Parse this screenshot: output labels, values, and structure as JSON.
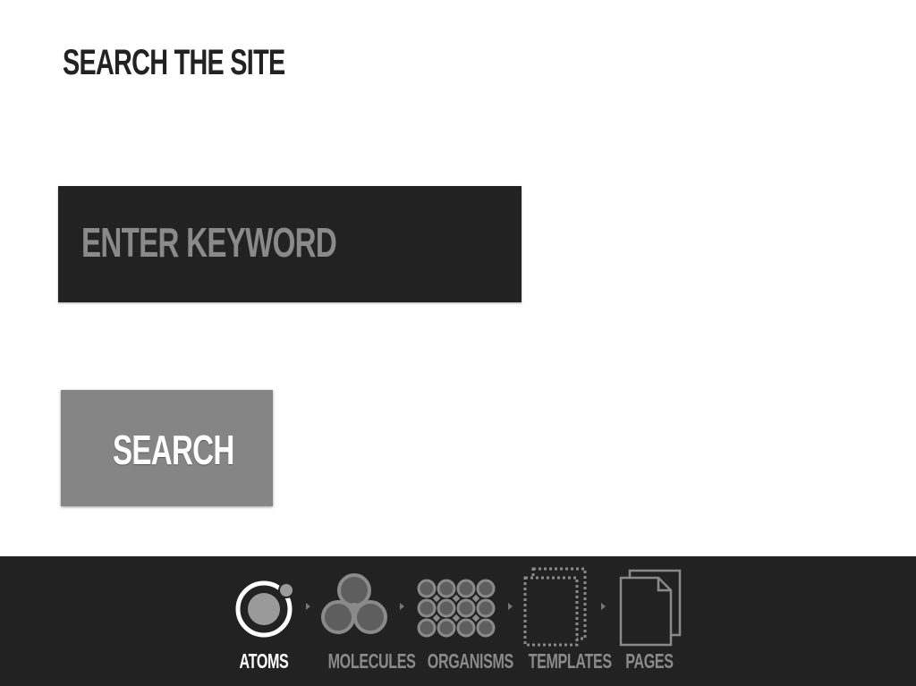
{
  "page": {
    "title": "SEARCH THE SITE"
  },
  "search": {
    "placeholder": "ENTER KEYWORD",
    "button_label": "SEARCH"
  },
  "footer": {
    "active_step": "ATOMS",
    "steps": [
      {
        "label": "ATOMS",
        "icon": "atom-icon"
      },
      {
        "label": "MOLECULES",
        "icon": "molecule-icon"
      },
      {
        "label": "ORGANISMS",
        "icon": "organism-icon"
      },
      {
        "label": "TEMPLATES",
        "icon": "template-icon"
      },
      {
        "label": "PAGES",
        "icon": "pages-icon"
      }
    ]
  },
  "colors": {
    "background": "#ffffff",
    "dark": "#222222",
    "button": "#858585",
    "muted_text": "#8a8a8a",
    "active_text": "#ffffff"
  }
}
